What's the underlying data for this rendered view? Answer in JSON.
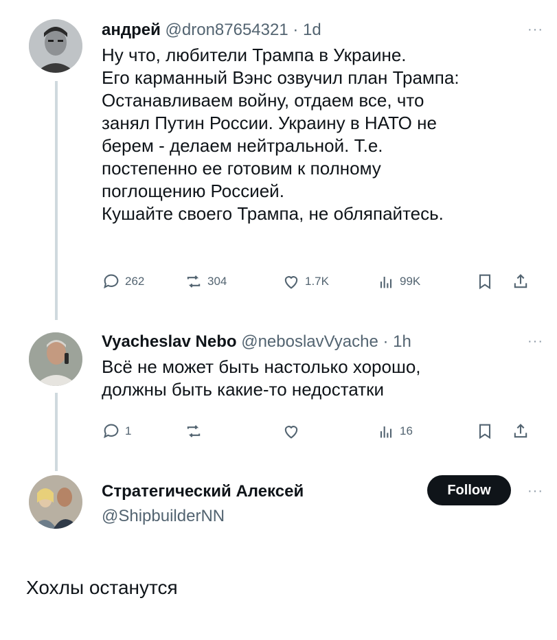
{
  "tweet1": {
    "name": "андрей",
    "handle": "@dron87654321",
    "time": "· 1d",
    "more": "···",
    "lines": [
      "Ну что, любители Трампа в Украине.",
      "Его карманный Вэнс озвучил план Трампа:",
      "Останавливаем войну, отдаем все, что",
      "занял Путин России. Украину в НАТО не",
      "берем - делаем нейтральной. Т.е.",
      "постепенно ее готовим к полному",
      "поглощению Россией.",
      "Кушайте своего Трампа, не обляпайтесь."
    ],
    "actions": {
      "replies": "262",
      "reposts": "304",
      "likes": "1.7K",
      "views": "99K"
    }
  },
  "tweet2": {
    "name": "Vyacheslav Nebo",
    "handle": "@neboslavVyache",
    "time": "· 1h",
    "more": "···",
    "lines": [
      "Всё не может быть настолько хорошо,",
      "должны быть какие-то недостатки"
    ],
    "actions": {
      "replies": "1",
      "views": "16"
    }
  },
  "tweet3": {
    "name": "Стратегический Алексей",
    "handle": "@ShipbuilderNN",
    "follow_label": "Follow",
    "more": "···",
    "text": "Хохлы останутся"
  },
  "colors": {
    "text": "#0f1419",
    "muted": "#536471",
    "thread_line": "#cfd9de",
    "follow_bg": "#0f1419"
  }
}
